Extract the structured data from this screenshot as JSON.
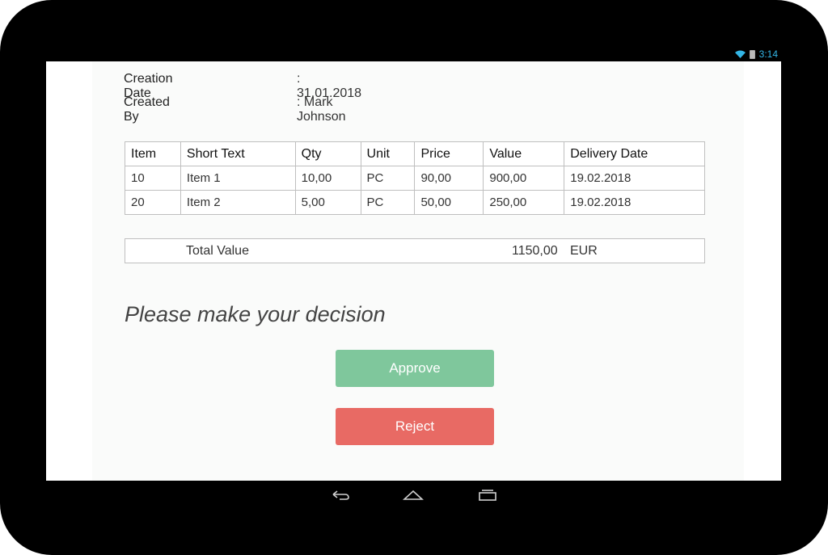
{
  "status_bar": {
    "time": "3:14",
    "icons": [
      "wifi-icon",
      "battery-icon"
    ]
  },
  "meta": {
    "creation_date_label": "Creation Date",
    "creation_date_value": ": 31.01.2018",
    "created_by_label": "Created By",
    "created_by_value": ": Mark Johnson"
  },
  "items_table": {
    "headers": [
      "Item",
      "Short Text",
      "Qty",
      "Unit",
      "Price",
      "Value",
      "Delivery Date"
    ],
    "rows": [
      [
        "10",
        "Item 1",
        "10,00",
        "PC",
        "90,00",
        "900,00",
        "19.02.2018"
      ],
      [
        "20",
        "Item 2",
        "5,00",
        "PC",
        "50,00",
        "250,00",
        "19.02.2018"
      ]
    ]
  },
  "total": {
    "label": "Total Value",
    "value": "1150,00",
    "currency": "EUR"
  },
  "decision_prompt": "Please make your decision",
  "buttons": {
    "approve_label": "Approve",
    "reject_label": "Reject"
  },
  "colors": {
    "approve": "#7fc79c",
    "reject": "#e86a64",
    "status_accent": "#33b5e5"
  },
  "nav_bar": {
    "icons": [
      "back-icon",
      "home-icon",
      "recent-apps-icon"
    ]
  }
}
